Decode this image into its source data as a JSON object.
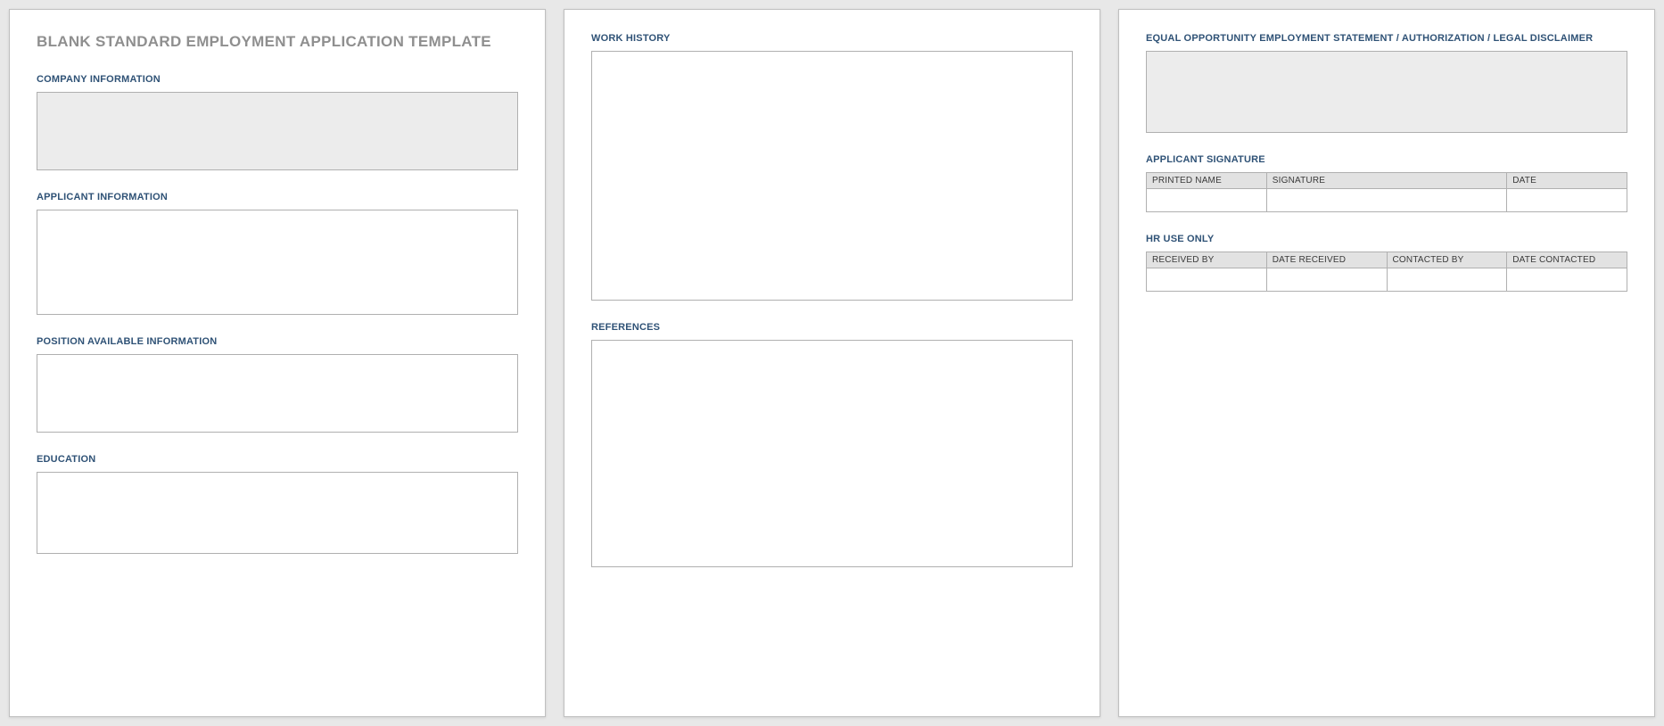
{
  "title": "BLANK STANDARD EMPLOYMENT APPLICATION TEMPLATE",
  "page1": {
    "company_info": "COMPANY INFORMATION",
    "applicant_info": "APPLICANT INFORMATION",
    "position_info": "POSITION AVAILABLE INFORMATION",
    "education": "EDUCATION"
  },
  "page2": {
    "work_history": "WORK HISTORY",
    "references": "REFERENCES"
  },
  "page3": {
    "eoe": "EQUAL OPPORTUNITY EMPLOYMENT STATEMENT / AUTHORIZATION / LEGAL DISCLAIMER",
    "signature_title": "APPLICANT SIGNATURE",
    "sig_cols": {
      "printed": "PRINTED NAME",
      "signature": "SIGNATURE",
      "date": "DATE"
    },
    "hr_title": "HR USE ONLY",
    "hr_cols": {
      "received_by": "RECEIVED BY",
      "date_received": "DATE RECEIVED",
      "contacted_by": "CONTACTED BY",
      "date_contacted": "DATE CONTACTED"
    }
  }
}
